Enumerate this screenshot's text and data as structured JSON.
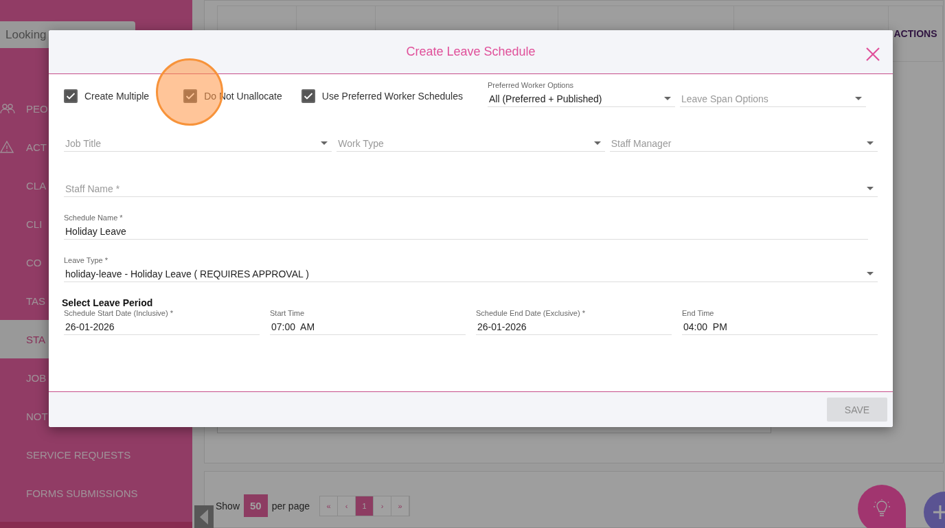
{
  "sidebar": {
    "search": {
      "placeholder": "Looking"
    },
    "items": [
      {
        "label": "PEO",
        "selected": false
      },
      {
        "label": "ACT",
        "selected": false
      },
      {
        "label": "CLA",
        "selected": false
      },
      {
        "label": "CLI",
        "selected": false
      },
      {
        "label": "CO",
        "selected": false
      },
      {
        "label": "TAS",
        "selected": false
      },
      {
        "label": "STA",
        "selected": true
      },
      {
        "label": "JOB",
        "selected": false
      },
      {
        "label": "NOT",
        "selected": false
      },
      {
        "label": "SERVICE REQUESTS",
        "selected": false
      },
      {
        "label": "FORMS SUBMISSIONS",
        "selected": false
      }
    ]
  },
  "table": {
    "last_column_heading": "ACTIONS"
  },
  "pagination": {
    "show": "Show",
    "page_size": "50",
    "per_page": "per page",
    "pages": [
      {
        "label": "«",
        "selected": false
      },
      {
        "label": "‹",
        "selected": false
      },
      {
        "label": "1",
        "selected": true
      },
      {
        "label": "›",
        "selected": false
      },
      {
        "label": "»",
        "selected": false
      }
    ]
  },
  "modal": {
    "title": "Create Leave Schedule",
    "checkboxes": [
      {
        "label": "Create Multiple",
        "checked": true,
        "highlighted": false
      },
      {
        "label": "Do Not Unallocate",
        "checked": true,
        "highlighted": true
      },
      {
        "label": "Use Preferred Worker Schedules",
        "checked": true,
        "highlighted": false
      }
    ],
    "option_selects": [
      {
        "label": "Preferred Worker Options",
        "value": "All (Preferred + Published)"
      },
      {
        "placeholder": "Leave Span Options"
      }
    ],
    "filter_selects": [
      {
        "placeholder": "Job Title"
      },
      {
        "placeholder": "Work Type"
      },
      {
        "placeholder": "Staff Manager"
      }
    ],
    "staff_name": {
      "placeholder": "Staff Name *"
    },
    "schedule_name": {
      "label": "Schedule Name *",
      "value": "Holiday Leave"
    },
    "leave_type": {
      "label": "Leave Type *",
      "value": "holiday-leave - Holiday Leave ( REQUIRES APPROVAL )"
    },
    "period_heading": "Select Leave Period",
    "period_fields": [
      {
        "label": "Schedule Start Date (Inclusive) *",
        "value": "26-01-2026"
      },
      {
        "label": "Start Time",
        "value": "07:00  AM"
      },
      {
        "label": "Schedule End Date (Exclusive) *",
        "value": "26-01-2026"
      },
      {
        "label": "End Time",
        "value": "04:00  PM"
      }
    ],
    "save_button": {
      "label": "SAVE",
      "disabled": true
    }
  }
}
